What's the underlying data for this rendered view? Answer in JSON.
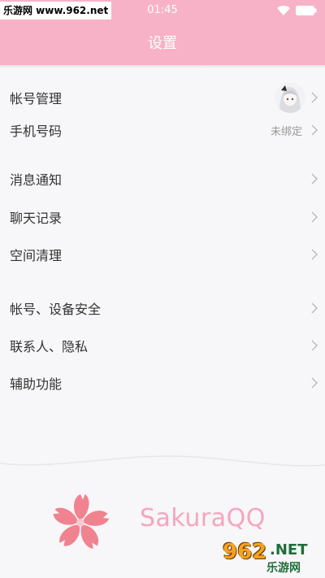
{
  "watermark_top": "乐游网 www.962.net",
  "status_bar": {
    "time": "01:45",
    "wifi_icon": "wifi-icon",
    "battery_icon": "battery-icon"
  },
  "header": {
    "title": "设置",
    "color": "#f8b2c8"
  },
  "groups": [
    {
      "items": [
        {
          "label": "帐号管理",
          "value": "",
          "has_avatar": true
        },
        {
          "label": "手机号码",
          "value": "未绑定"
        }
      ]
    },
    {
      "items": [
        {
          "label": "消息通知"
        },
        {
          "label": "聊天记录"
        },
        {
          "label": "空间清理"
        }
      ]
    },
    {
      "items": [
        {
          "label": "帐号、设备安全"
        },
        {
          "label": "联系人、隐私"
        },
        {
          "label": "辅助功能"
        }
      ]
    }
  ],
  "footer": {
    "brand": "SakuraQQ",
    "flower_icon": "sakura-flower-icon",
    "brand_color": "#f4a6bd"
  },
  "watermark_logo": {
    "number": "962",
    "suffix": ".NET",
    "text": "乐游网"
  }
}
